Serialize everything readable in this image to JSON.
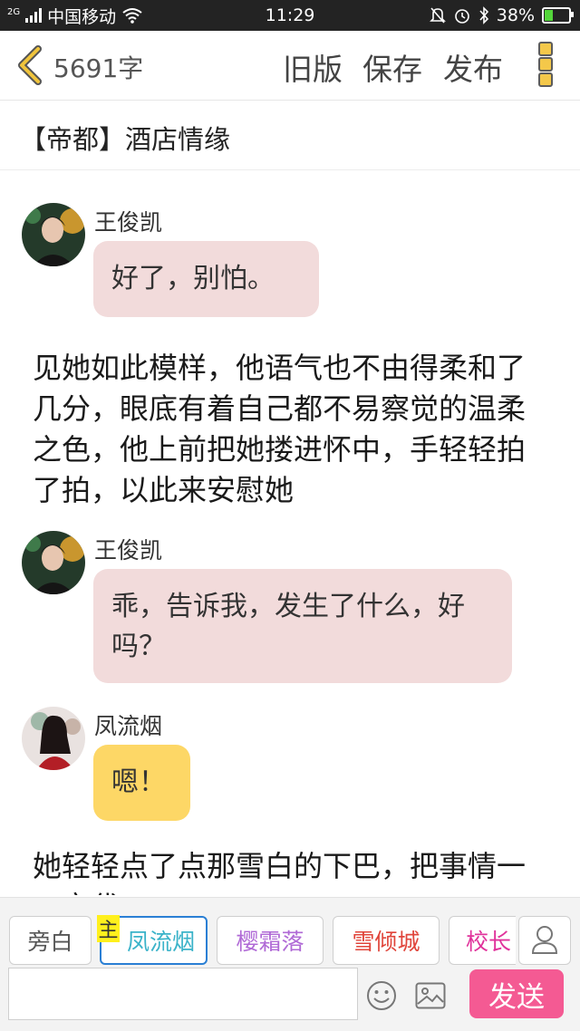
{
  "status_bar": {
    "network": "2G",
    "carrier": "中国移动",
    "time": "11:29",
    "battery": "38%",
    "battery_level": 0.38
  },
  "topbar": {
    "word_count": "5691字",
    "old_version": "旧版",
    "save": "保存",
    "publish": "发布"
  },
  "story": {
    "title": "【帝都】酒店情缘"
  },
  "messages": [
    {
      "type": "dialog",
      "speaker": "王俊凯",
      "text": "好了，别怕。",
      "bubble_color": "#f2dbdb"
    },
    {
      "type": "narration",
      "text": "见她如此模样，他语气也不由得柔和了几分，眼底有着自己都不易察觉的温柔之色，他上前把她搂进怀中，手轻轻拍了拍，以此来安慰她"
    },
    {
      "type": "dialog",
      "speaker": "王俊凯",
      "text": "乖，告诉我，发生了什么，好吗？",
      "bubble_color": "#f2dbdb"
    },
    {
      "type": "dialog",
      "speaker": "凤流烟",
      "text": "嗯！",
      "bubble_color": "#fdd766"
    },
    {
      "type": "narration",
      "text": "她轻轻点了点那雪白的下巴，把事情一一交代…"
    }
  ],
  "roles": {
    "main_badge": "主",
    "items": [
      {
        "label": "旁白",
        "color": "#555555"
      },
      {
        "label": "凤流烟",
        "color": "#3ab3c9",
        "selected": true
      },
      {
        "label": "樱霜落",
        "color": "#b06ad6"
      },
      {
        "label": "雪倾城",
        "color": "#e0443a"
      },
      {
        "label": "校长",
        "color": "#e0339b"
      }
    ]
  },
  "input": {
    "placeholder": "",
    "value": "",
    "send": "发送"
  },
  "colors": {
    "accent": "#f45a93",
    "back_arrow": "#f0c43c",
    "selected_border": "#2a7fd4"
  }
}
